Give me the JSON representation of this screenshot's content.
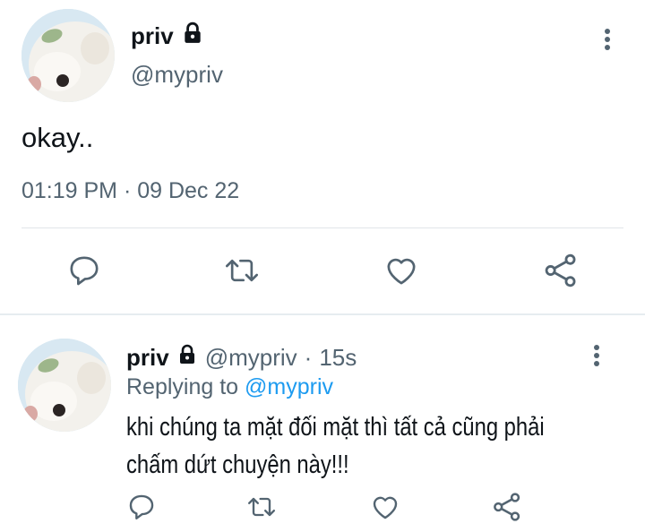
{
  "main_tweet": {
    "display_name": "priv",
    "handle": "@mypriv",
    "text": "okay..",
    "timestamp": "01:19 PM · 09 Dec 22",
    "icons": {
      "lock": "lock-icon",
      "more": "more-vertical-icon",
      "reply": "reply-icon",
      "retweet": "retweet-icon",
      "like": "like-icon",
      "share": "share-icon"
    }
  },
  "reply_tweet": {
    "display_name": "priv",
    "handle": "@mypriv",
    "separator": "·",
    "age": "15s",
    "replying_prefix": "Replying to",
    "replying_to": "@mypriv",
    "text_line1": "khi chúng ta mặt đối mặt thì tất cả cũng phải",
    "text_line2": "chấm dứt chuyện này!!!"
  },
  "colors": {
    "primary_text": "#0f1419",
    "secondary_text": "#536471",
    "link": "#1d9bf0",
    "divider": "#e1e5e9"
  }
}
